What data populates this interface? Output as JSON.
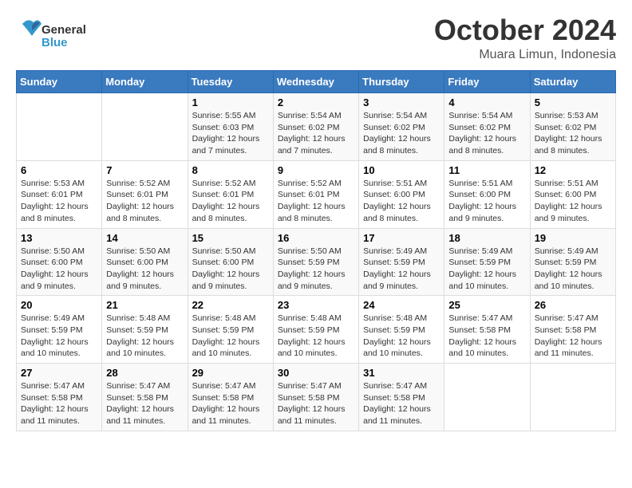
{
  "header": {
    "logo": {
      "text_general": "General",
      "text_blue": "Blue"
    },
    "title": "October 2024",
    "location": "Muara Limun, Indonesia"
  },
  "weekdays": [
    "Sunday",
    "Monday",
    "Tuesday",
    "Wednesday",
    "Thursday",
    "Friday",
    "Saturday"
  ],
  "weeks": [
    [
      {
        "day": "",
        "info": ""
      },
      {
        "day": "",
        "info": ""
      },
      {
        "day": "1",
        "info": "Sunrise: 5:55 AM\nSunset: 6:03 PM\nDaylight: 12 hours and 7 minutes."
      },
      {
        "day": "2",
        "info": "Sunrise: 5:54 AM\nSunset: 6:02 PM\nDaylight: 12 hours and 7 minutes."
      },
      {
        "day": "3",
        "info": "Sunrise: 5:54 AM\nSunset: 6:02 PM\nDaylight: 12 hours and 8 minutes."
      },
      {
        "day": "4",
        "info": "Sunrise: 5:54 AM\nSunset: 6:02 PM\nDaylight: 12 hours and 8 minutes."
      },
      {
        "day": "5",
        "info": "Sunrise: 5:53 AM\nSunset: 6:02 PM\nDaylight: 12 hours and 8 minutes."
      }
    ],
    [
      {
        "day": "6",
        "info": "Sunrise: 5:53 AM\nSunset: 6:01 PM\nDaylight: 12 hours and 8 minutes."
      },
      {
        "day": "7",
        "info": "Sunrise: 5:52 AM\nSunset: 6:01 PM\nDaylight: 12 hours and 8 minutes."
      },
      {
        "day": "8",
        "info": "Sunrise: 5:52 AM\nSunset: 6:01 PM\nDaylight: 12 hours and 8 minutes."
      },
      {
        "day": "9",
        "info": "Sunrise: 5:52 AM\nSunset: 6:01 PM\nDaylight: 12 hours and 8 minutes."
      },
      {
        "day": "10",
        "info": "Sunrise: 5:51 AM\nSunset: 6:00 PM\nDaylight: 12 hours and 8 minutes."
      },
      {
        "day": "11",
        "info": "Sunrise: 5:51 AM\nSunset: 6:00 PM\nDaylight: 12 hours and 9 minutes."
      },
      {
        "day": "12",
        "info": "Sunrise: 5:51 AM\nSunset: 6:00 PM\nDaylight: 12 hours and 9 minutes."
      }
    ],
    [
      {
        "day": "13",
        "info": "Sunrise: 5:50 AM\nSunset: 6:00 PM\nDaylight: 12 hours and 9 minutes."
      },
      {
        "day": "14",
        "info": "Sunrise: 5:50 AM\nSunset: 6:00 PM\nDaylight: 12 hours and 9 minutes."
      },
      {
        "day": "15",
        "info": "Sunrise: 5:50 AM\nSunset: 6:00 PM\nDaylight: 12 hours and 9 minutes."
      },
      {
        "day": "16",
        "info": "Sunrise: 5:50 AM\nSunset: 5:59 PM\nDaylight: 12 hours and 9 minutes."
      },
      {
        "day": "17",
        "info": "Sunrise: 5:49 AM\nSunset: 5:59 PM\nDaylight: 12 hours and 9 minutes."
      },
      {
        "day": "18",
        "info": "Sunrise: 5:49 AM\nSunset: 5:59 PM\nDaylight: 12 hours and 10 minutes."
      },
      {
        "day": "19",
        "info": "Sunrise: 5:49 AM\nSunset: 5:59 PM\nDaylight: 12 hours and 10 minutes."
      }
    ],
    [
      {
        "day": "20",
        "info": "Sunrise: 5:49 AM\nSunset: 5:59 PM\nDaylight: 12 hours and 10 minutes."
      },
      {
        "day": "21",
        "info": "Sunrise: 5:48 AM\nSunset: 5:59 PM\nDaylight: 12 hours and 10 minutes."
      },
      {
        "day": "22",
        "info": "Sunrise: 5:48 AM\nSunset: 5:59 PM\nDaylight: 12 hours and 10 minutes."
      },
      {
        "day": "23",
        "info": "Sunrise: 5:48 AM\nSunset: 5:59 PM\nDaylight: 12 hours and 10 minutes."
      },
      {
        "day": "24",
        "info": "Sunrise: 5:48 AM\nSunset: 5:59 PM\nDaylight: 12 hours and 10 minutes."
      },
      {
        "day": "25",
        "info": "Sunrise: 5:47 AM\nSunset: 5:58 PM\nDaylight: 12 hours and 10 minutes."
      },
      {
        "day": "26",
        "info": "Sunrise: 5:47 AM\nSunset: 5:58 PM\nDaylight: 12 hours and 11 minutes."
      }
    ],
    [
      {
        "day": "27",
        "info": "Sunrise: 5:47 AM\nSunset: 5:58 PM\nDaylight: 12 hours and 11 minutes."
      },
      {
        "day": "28",
        "info": "Sunrise: 5:47 AM\nSunset: 5:58 PM\nDaylight: 12 hours and 11 minutes."
      },
      {
        "day": "29",
        "info": "Sunrise: 5:47 AM\nSunset: 5:58 PM\nDaylight: 12 hours and 11 minutes."
      },
      {
        "day": "30",
        "info": "Sunrise: 5:47 AM\nSunset: 5:58 PM\nDaylight: 12 hours and 11 minutes."
      },
      {
        "day": "31",
        "info": "Sunrise: 5:47 AM\nSunset: 5:58 PM\nDaylight: 12 hours and 11 minutes."
      },
      {
        "day": "",
        "info": ""
      },
      {
        "day": "",
        "info": ""
      }
    ]
  ]
}
